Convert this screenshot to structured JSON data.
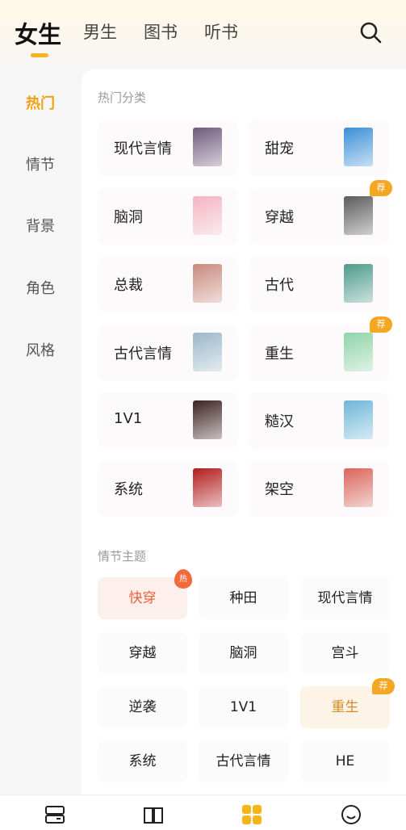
{
  "header": {
    "tabs": [
      "女生",
      "男生",
      "图书",
      "听书"
    ],
    "active_tab": "女生",
    "search_icon": "search-icon"
  },
  "sidebar": {
    "items": [
      "热门",
      "情节",
      "背景",
      "角色",
      "风格"
    ],
    "active": "热门"
  },
  "hot_categories": {
    "title": "热门分类",
    "items": [
      {
        "label": "现代言情",
        "badge": "",
        "cover_color": "#6f5a7d"
      },
      {
        "label": "甜宠",
        "badge": "",
        "cover_color": "#3b8fd8"
      },
      {
        "label": "脑洞",
        "badge": "",
        "cover_color": "#f3b4c2"
      },
      {
        "label": "穿越",
        "badge": "荐",
        "cover_color": "#5b5b5b"
      },
      {
        "label": "总裁",
        "badge": "",
        "cover_color": "#c98a7d"
      },
      {
        "label": "古代",
        "badge": "",
        "cover_color": "#4d9a8a"
      },
      {
        "label": "古代言情",
        "badge": "",
        "cover_color": "#9bb8c9"
      },
      {
        "label": "重生",
        "badge": "荐",
        "cover_color": "#8fd3a8"
      },
      {
        "label": "1V1",
        "badge": "",
        "cover_color": "#3d2222"
      },
      {
        "label": "糙汉",
        "badge": "",
        "cover_color": "#6fb6d9"
      },
      {
        "label": "系统",
        "badge": "",
        "cover_color": "#b21d1d"
      },
      {
        "label": "架空",
        "badge": "",
        "cover_color": "#d9655a"
      }
    ]
  },
  "plot_themes": {
    "title": "情节主题",
    "items": [
      {
        "label": "快穿",
        "badge": "热"
      },
      {
        "label": "种田",
        "badge": ""
      },
      {
        "label": "现代言情",
        "badge": ""
      },
      {
        "label": "穿越",
        "badge": ""
      },
      {
        "label": "脑洞",
        "badge": ""
      },
      {
        "label": "宫斗",
        "badge": ""
      },
      {
        "label": "逆袭",
        "badge": ""
      },
      {
        "label": "1V1",
        "badge": ""
      },
      {
        "label": "重生",
        "badge": "荐"
      },
      {
        "label": "系统",
        "badge": ""
      },
      {
        "label": "古代言情",
        "badge": ""
      },
      {
        "label": "HE",
        "badge": ""
      }
    ]
  },
  "bottom_nav": {
    "items": [
      "shelf-icon",
      "book-icon",
      "category-icon",
      "profile-icon"
    ],
    "active": "category-icon",
    "active_color": "#f4b41a"
  }
}
